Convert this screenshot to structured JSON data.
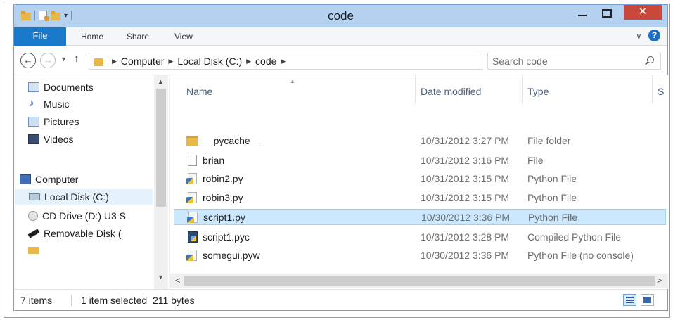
{
  "window": {
    "title": "code",
    "close_glyph": "✕"
  },
  "ribbon": {
    "file": "File",
    "home": "Home",
    "share": "Share",
    "view": "View",
    "chevron": "∨",
    "help": "?"
  },
  "nav": {
    "back_glyph": "←",
    "forward_glyph": "→",
    "recent_glyph": "▼",
    "up_glyph": "↑",
    "breadcrumb": [
      "Computer",
      "Local Disk (C:)",
      "code"
    ],
    "crumb_sep": "▶",
    "addr_dropdown": "∨",
    "refresh_glyph": "↻",
    "search_placeholder": "Search code"
  },
  "navpane": {
    "items": [
      {
        "label": "Documents",
        "icon": "documents-icon"
      },
      {
        "label": "Music",
        "icon": "music-icon"
      },
      {
        "label": "Pictures",
        "icon": "pictures-icon"
      },
      {
        "label": "Videos",
        "icon": "videos-icon"
      },
      {
        "label": "Computer",
        "icon": "computer-icon"
      },
      {
        "label": "Local Disk (C:)",
        "icon": "disk-icon",
        "selected": true
      },
      {
        "label": "CD Drive (D:) U3 S",
        "icon": "cd-drive-icon"
      },
      {
        "label": "Removable Disk (",
        "icon": "usb-icon"
      },
      {
        "label": "",
        "icon": "folder-icon"
      }
    ],
    "scroll_up": "▲",
    "scroll_down": "▼"
  },
  "columns": {
    "name": "Name",
    "date": "Date modified",
    "type": "Type",
    "size": "S",
    "sort_glyph": "▲"
  },
  "files": [
    {
      "name": "__pycache__",
      "date": "10/31/2012 3:27 PM",
      "type": "File folder",
      "icon": "folder-icon"
    },
    {
      "name": "brian",
      "date": "10/31/2012 3:16 PM",
      "type": "File",
      "icon": "file-icon"
    },
    {
      "name": "robin2.py",
      "date": "10/31/2012 3:15 PM",
      "type": "Python File",
      "icon": "python-file-icon"
    },
    {
      "name": "robin3.py",
      "date": "10/31/2012 3:15 PM",
      "type": "Python File",
      "icon": "python-file-icon"
    },
    {
      "name": "script1.py",
      "date": "10/30/2012 3:36 PM",
      "type": "Python File",
      "icon": "python-file-icon",
      "selected": true
    },
    {
      "name": "script1.pyc",
      "date": "10/31/2012 3:28 PM",
      "type": "Compiled Python File",
      "icon": "compiled-python-icon"
    },
    {
      "name": "somegui.pyw",
      "date": "10/30/2012 3:36 PM",
      "type": "Python File (no console)",
      "icon": "python-file-icon"
    }
  ],
  "hscroll": {
    "left": "<",
    "right": ">"
  },
  "status": {
    "items": "7 items",
    "selection": "1 item selected  211 bytes"
  }
}
